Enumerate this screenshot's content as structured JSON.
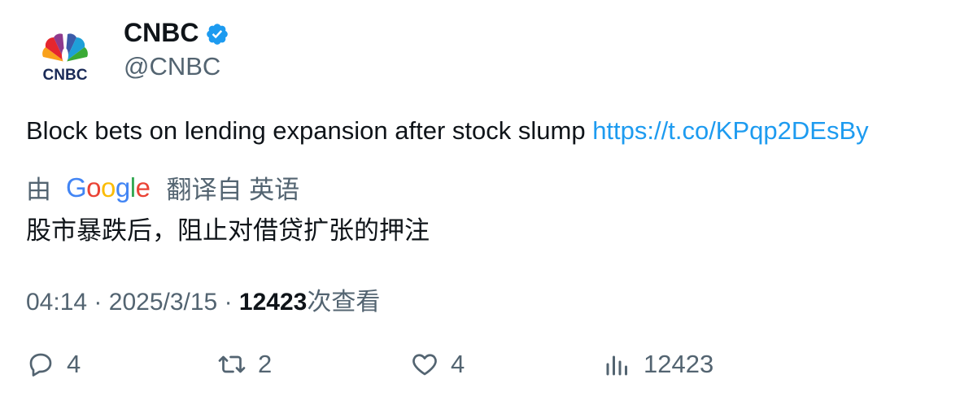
{
  "author": {
    "display_name": "CNBC",
    "handle": "@CNBC",
    "avatar_text": "CNBC"
  },
  "tweet": {
    "text": "Block bets on lending expansion after stock slump",
    "link": "https://t.co/KPqp2DEsBy"
  },
  "translation": {
    "prefix": "由",
    "provider": "Google",
    "suffix": "翻译自 英语",
    "text": "股市暴跌后，阻止对借贷扩张的押注"
  },
  "meta": {
    "time": "04:14",
    "separator": "·",
    "date": "2025/3/15",
    "views_count": "12423",
    "views_label": "次查看"
  },
  "actions": {
    "replies": "4",
    "retweets": "2",
    "likes": "4",
    "views": "12423"
  },
  "colors": {
    "link": "#1d9bf0",
    "muted": "#536471",
    "text": "#0f1419",
    "verified": "#1d9bf0"
  }
}
